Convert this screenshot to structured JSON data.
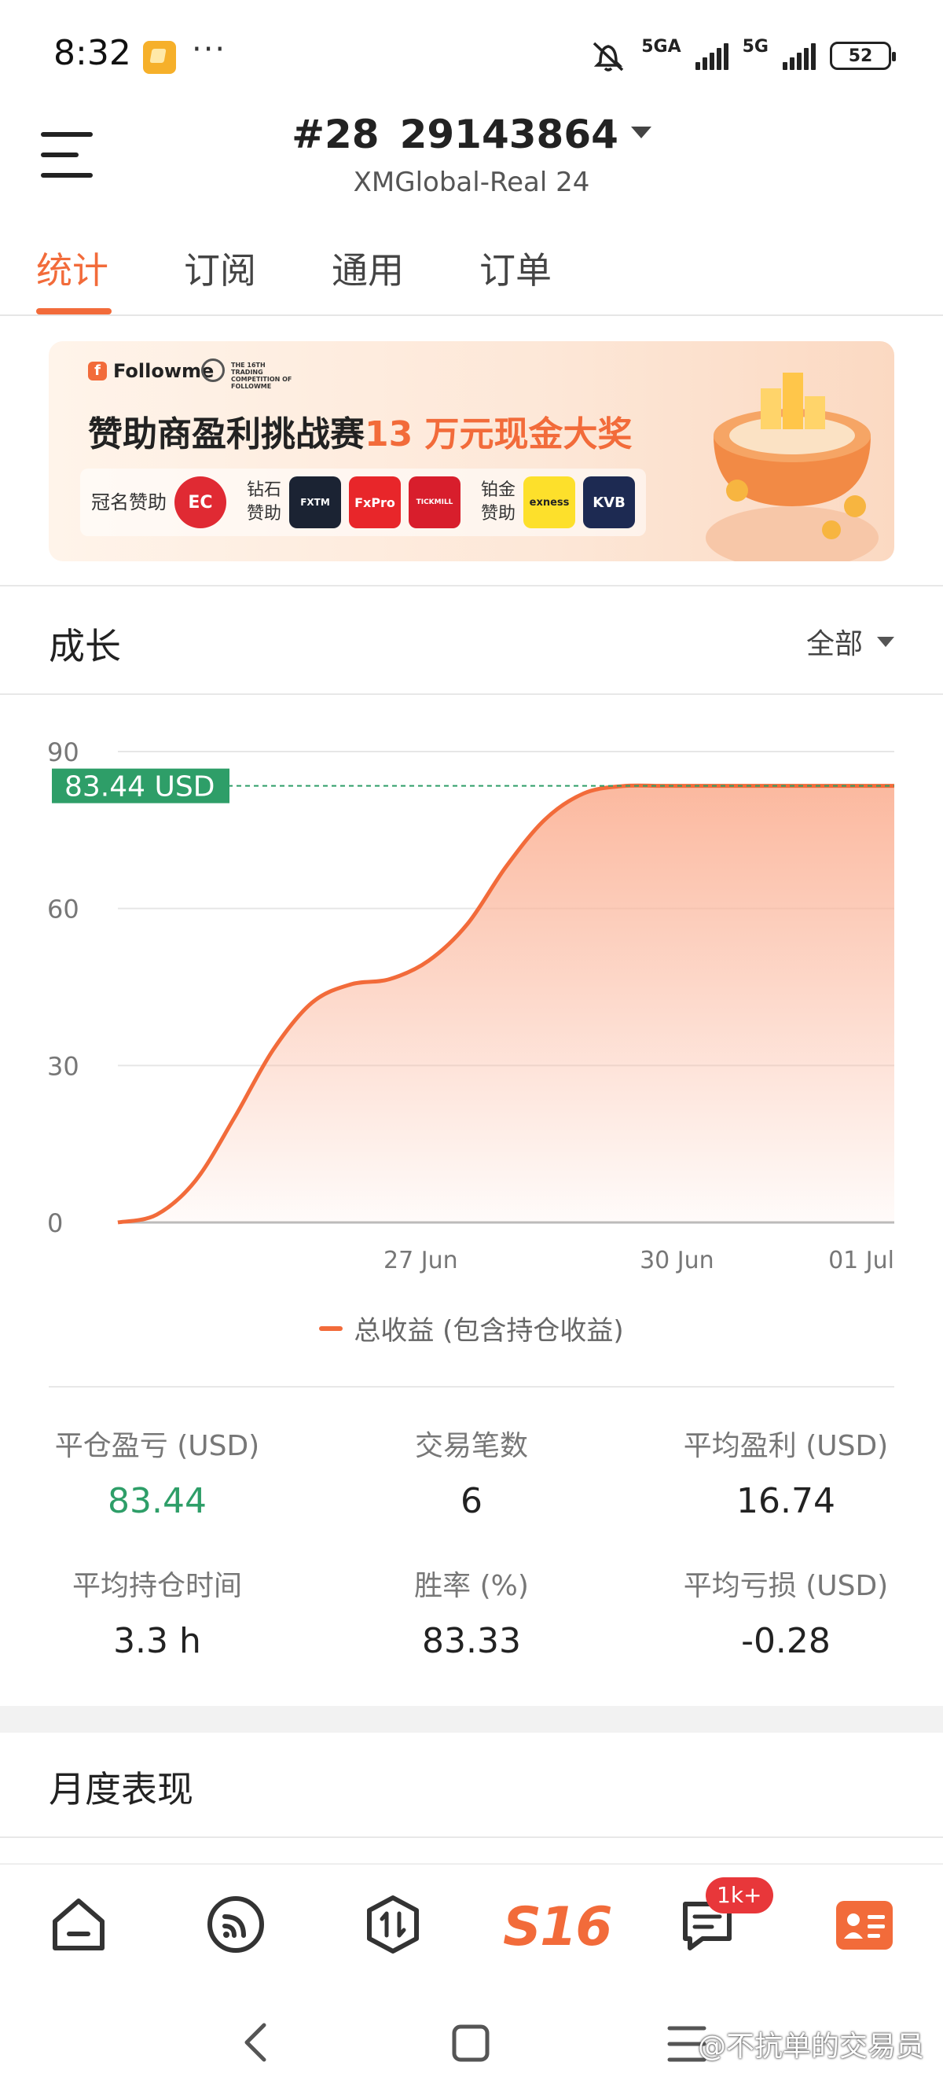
{
  "status_bar": {
    "time": "8:32",
    "dots": "···",
    "net1": "5GA",
    "net2": "5G",
    "battery": "52"
  },
  "header": {
    "rank": "#28",
    "account": "29143864",
    "server": "XMGlobal-Real 24"
  },
  "tabs": [
    "统计",
    "订阅",
    "通用",
    "订单"
  ],
  "active_tab": 0,
  "banner": {
    "brand": "Followme",
    "competition": "THE 16TH TRADING COMPETITION OF FOLLOWME",
    "title_prefix": "赞助商盈利挑战赛",
    "title_highlight": "13 万元现金大奖",
    "sponsor_title_label": "冠名赞助",
    "diamond_label": "钻石赞助",
    "platinum_label": "铂金赞助",
    "sponsors": [
      "EC",
      "FXTM",
      "FxPro",
      "TICKMILL",
      "exness",
      "KVB"
    ]
  },
  "growth": {
    "title": "成长",
    "filter": "全部"
  },
  "chart_data": {
    "type": "area",
    "y_ticks": [
      "90",
      "60",
      "30",
      "0"
    ],
    "ylim": [
      0,
      90
    ],
    "x_ticks": [
      "27 Jun",
      "30 Jun",
      "01 Jul"
    ],
    "current_label": "83.44 USD",
    "current_value": 83.44,
    "series": [
      {
        "name": "总收益 (包含持仓收益)",
        "x": [
          0,
          0.05,
          0.1,
          0.15,
          0.2,
          0.25,
          0.3,
          0.35,
          0.4,
          0.45,
          0.5,
          0.55,
          0.6,
          0.65,
          0.7,
          0.75,
          0.8,
          0.85,
          0.9,
          0.95,
          1.0
        ],
        "values": [
          0,
          1.5,
          8,
          20,
          33,
          42,
          45.5,
          46.5,
          50,
          57,
          68,
          77,
          82,
          83.4,
          83.44,
          83.44,
          83.44,
          83.44,
          83.44,
          83.44,
          83.44
        ]
      }
    ],
    "colors": {
      "line": "#f26b3a",
      "fill": "#fbb59a",
      "ref": "#2e9e68"
    }
  },
  "stats": [
    {
      "label": "平仓盈亏 (USD)",
      "value": "83.44",
      "color": "green"
    },
    {
      "label": "交易笔数",
      "value": "6"
    },
    {
      "label": "平均盈利 (USD)",
      "value": "16.74"
    },
    {
      "label": "平均持仓时间",
      "value": "3.3 h"
    },
    {
      "label": "胜率 (%)",
      "value": "83.33"
    },
    {
      "label": "平均亏损 (USD)",
      "value": "-0.28"
    }
  ],
  "monthly": {
    "title": "月度表现"
  },
  "bottom_nav": {
    "items": [
      "home-icon",
      "feed-icon",
      "trade-icon",
      "s16-icon",
      "messages-icon",
      "profile-icon"
    ],
    "s16_label": "S16",
    "badge": "1k+"
  },
  "watermark": "@不抗单的交易员"
}
